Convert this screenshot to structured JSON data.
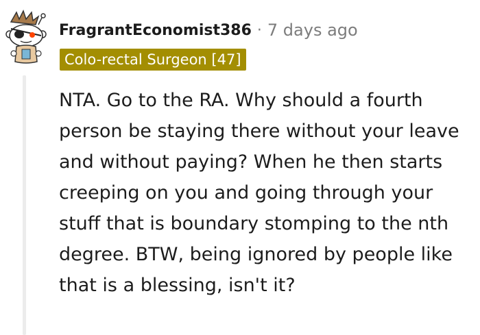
{
  "comment": {
    "username": "FragrantEconomist386",
    "separator": "·",
    "timestamp": "7 days ago",
    "flair": "Colo-rectal Surgeon [47]",
    "body": "NTA. Go to the RA. Why should a fourth person be staying there without your leave and without paying? When he then starts creeping on you and going through your stuff that is boundary stomping to the nth degree. BTW, being ignored by people like that is a blessing, isn't it?",
    "avatar_icon": "snoo-avatar-icon"
  },
  "colors": {
    "flair_background": "#a38e02",
    "flair_text": "#ffffff",
    "meta_text": "#7c7c7c",
    "body_text": "#1c1c1c",
    "thread_line": "#ececec"
  }
}
